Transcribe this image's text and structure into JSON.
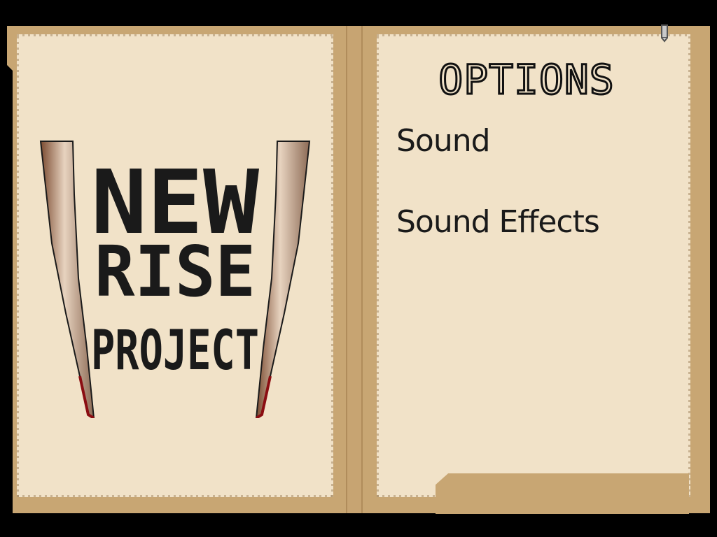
{
  "logo": {
    "line1": "NEW",
    "line2": "RISE",
    "line3": "PROJECT"
  },
  "options": {
    "title": "OPTIONS",
    "items": [
      {
        "label": "Sound"
      },
      {
        "label": "Sound Effects"
      }
    ]
  },
  "colors": {
    "folder": "#c8a673",
    "page": "#f1e2c8",
    "text": "#1a1a1a",
    "blood": "#8b0d12"
  },
  "icons": {
    "corner": "bookmark-icon"
  }
}
